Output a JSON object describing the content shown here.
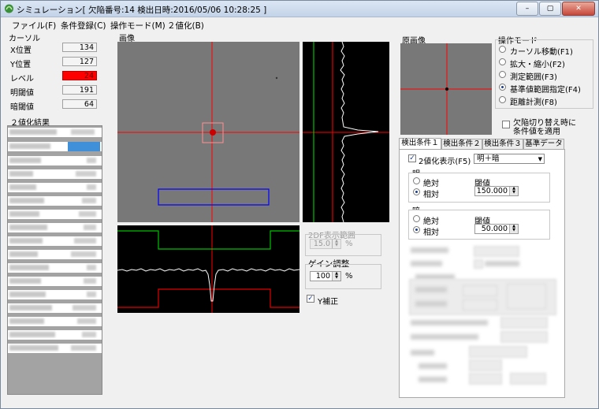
{
  "window": {
    "title": "シミュレーション[ 欠陥番号:14  検出日時:2016/05/06 10:28:25 ]",
    "buttons": {
      "minimize": "–",
      "maximize": "▢",
      "close": "✕"
    }
  },
  "menu": [
    {
      "label": "ファイル(F)"
    },
    {
      "label": "条件登録(C)"
    },
    {
      "label": "操作モード(M)"
    },
    {
      "label": "２値化(B)"
    }
  ],
  "cursor": {
    "group_label": "カーソル",
    "fields": [
      {
        "label": "X位置",
        "value": "134"
      },
      {
        "label": "Y位置",
        "value": "127"
      },
      {
        "label": "レベル",
        "value": "24"
      },
      {
        "label": "明閾値",
        "value": "191"
      },
      {
        "label": "暗閾値",
        "value": "64"
      }
    ]
  },
  "binarize_results": {
    "label": "２値化結果"
  },
  "image_panel": {
    "label": "画像"
  },
  "original_panel": {
    "label": "原画像"
  },
  "operation_mode": {
    "label": "操作モード",
    "options": [
      {
        "label": "カーソル移動(F1)",
        "selected": false
      },
      {
        "label": "拡大・縮小(F2)",
        "selected": false
      },
      {
        "label": "測定範囲(F3)",
        "selected": false
      },
      {
        "label": "基準値範囲指定(F4)",
        "selected": true
      },
      {
        "label": "距離計測(F8)",
        "selected": false
      }
    ]
  },
  "defect_switch": {
    "label_line1": "欠陥切り替え時に",
    "label_line2": "条件値を適用",
    "checked": false
  },
  "zoom": {
    "label": "2DF表示範囲",
    "value": "15.0",
    "unit": "%"
  },
  "gain": {
    "label": "ゲイン調整",
    "value": "100",
    "unit": "%"
  },
  "y_correction": {
    "label": "Y補正",
    "checked": true
  },
  "tabs": [
    {
      "label": "検出条件１",
      "active": true
    },
    {
      "label": "検出条件２",
      "active": false
    },
    {
      "label": "検出条件３",
      "active": false
    },
    {
      "label": "基準データ",
      "active": false
    }
  ],
  "detect": {
    "binary_display": {
      "label": "2値化表示(F5)",
      "checked": true
    },
    "mode": {
      "value": "明＋暗"
    },
    "bright": {
      "label": "明",
      "absolute": "絶対",
      "relative": "相対",
      "selected": "relative",
      "threshold_label": "閾値",
      "threshold_value": "150.000"
    },
    "dark": {
      "label": "暗",
      "absolute": "絶対",
      "relative": "相対",
      "selected": "relative",
      "threshold_label": "閾値",
      "threshold_value": "50.000"
    }
  },
  "colors": {
    "crosshair": "#ff0000",
    "plot_green": "#00c000",
    "plot_red": "#e00000",
    "roi_blue": "#0000ff",
    "level_red": "#ff0000"
  }
}
